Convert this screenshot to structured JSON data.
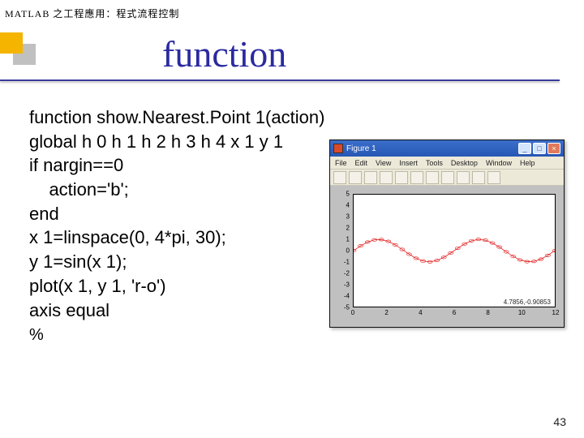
{
  "header": {
    "text": "MATLAB 之工程應用：程式流程控制"
  },
  "title": {
    "text": "function"
  },
  "code": {
    "lines": [
      "function show.Nearest.Point 1(action)",
      "global h 0 h 1 h 2 h 3 h 4 x 1 y 1",
      "if nargin==0",
      "    action='b';",
      "end",
      "x 1=linspace(0, 4*pi, 30);",
      "y 1=sin(x 1);",
      "plot(x 1, y 1, 'r-o')",
      "axis equal"
    ],
    "pct": "%"
  },
  "figure": {
    "title": "Figure 1",
    "menu": [
      "File",
      "Edit",
      "View",
      "Insert",
      "Tools",
      "Desktop",
      "Window",
      "Help"
    ],
    "winbtns": {
      "min": "_",
      "max": "□",
      "close": "×"
    },
    "xticks": [
      "0",
      "2",
      "4",
      "6",
      "8",
      "10",
      "12"
    ],
    "yticks": [
      "5",
      "4",
      "3",
      "2",
      "1",
      "0",
      "-1",
      "-2",
      "-3",
      "-4",
      "-5"
    ],
    "coord_readout": "4.7856,-0.90853"
  },
  "chart_data": {
    "type": "line",
    "title": "",
    "xlabel": "",
    "ylabel": "",
    "xlim": [
      0,
      12.57
    ],
    "ylim": [
      -5,
      5
    ],
    "x": [
      0.0,
      0.433,
      0.867,
      1.3,
      1.734,
      2.167,
      2.601,
      3.034,
      3.467,
      3.901,
      4.334,
      4.768,
      5.201,
      5.635,
      6.068,
      6.501,
      6.935,
      7.368,
      7.802,
      8.235,
      8.669,
      9.102,
      9.535,
      9.969,
      10.402,
      10.836,
      11.269,
      11.703,
      12.136,
      12.566
    ],
    "y": [
      0.0,
      0.42,
      0.762,
      0.964,
      0.987,
      0.827,
      0.516,
      0.108,
      -0.323,
      -0.688,
      -0.93,
      -0.999,
      -0.884,
      -0.603,
      -0.214,
      0.215,
      0.604,
      0.885,
      0.999,
      0.929,
      0.687,
      0.322,
      -0.108,
      -0.516,
      -0.827,
      -0.987,
      -0.964,
      -0.762,
      -0.42,
      0.0
    ],
    "series_style": "r-o"
  },
  "page": {
    "number": "43"
  }
}
